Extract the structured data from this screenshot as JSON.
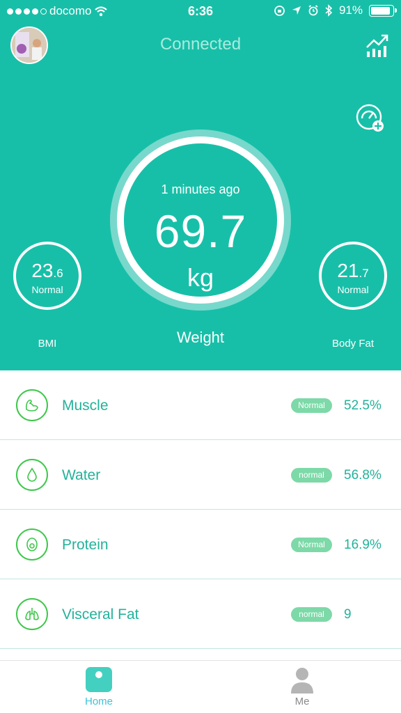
{
  "status_bar": {
    "carrier": "docomo",
    "time": "6:36",
    "battery": "91%"
  },
  "header": {
    "title": "Connected"
  },
  "weight": {
    "time_ago": "1 minutes ago",
    "value": "69.7",
    "unit": "kg",
    "label": "Weight"
  },
  "bmi": {
    "int": "23",
    "dec": ".6",
    "status": "Normal",
    "label": "BMI"
  },
  "body_fat": {
    "int": "21",
    "dec": ".7",
    "status": "Normal",
    "label": "Body Fat"
  },
  "metrics": [
    {
      "name": "Muscle",
      "badge": "Normal",
      "value": "52.5%",
      "icon": "muscle-icon"
    },
    {
      "name": "Water",
      "badge": "normal",
      "value": "56.8%",
      "icon": "water-drop-icon"
    },
    {
      "name": "Protein",
      "badge": "Normal",
      "value": "16.9%",
      "icon": "protein-icon"
    },
    {
      "name": "Visceral Fat",
      "badge": "normal",
      "value": "9",
      "icon": "lungs-icon"
    }
  ],
  "tabs": {
    "home": "Home",
    "me": "Me"
  },
  "colors": {
    "primary": "#18bfa8",
    "accent_text": "#22b29a",
    "icon_green": "#3ec74a",
    "badge": "#7dd9a8",
    "tab_active": "#3cc4d6"
  }
}
